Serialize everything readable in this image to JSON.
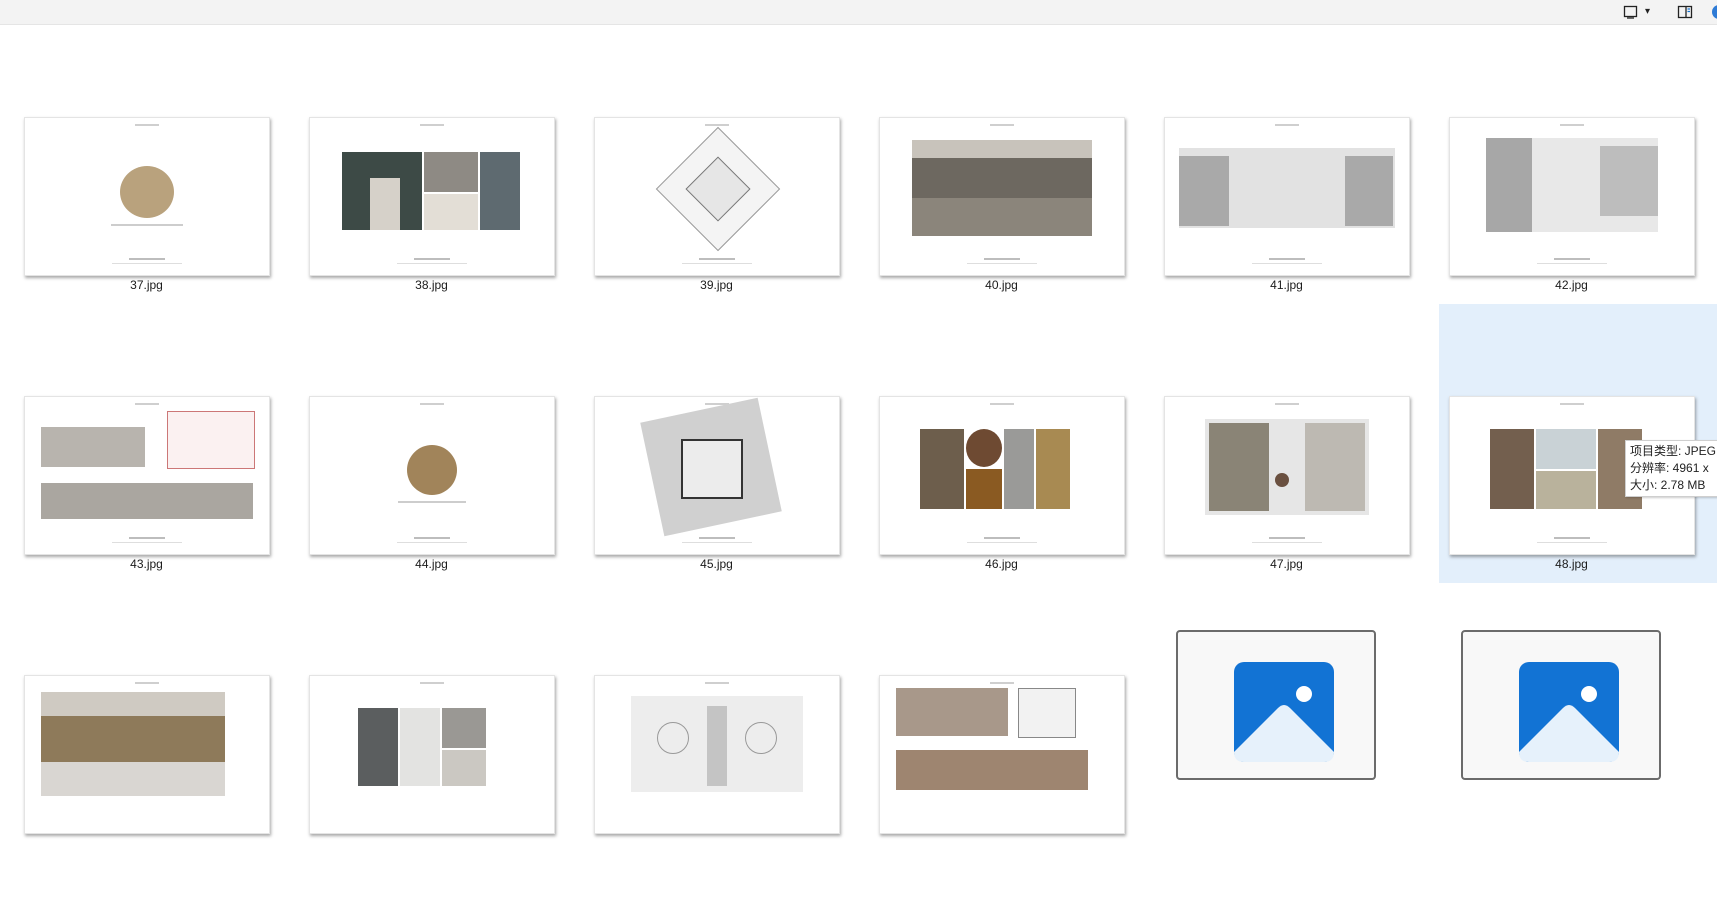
{
  "toolbar": {
    "view_icon": "monitor-icon",
    "view_caret": "▾",
    "details_pane_icon": "details-pane-icon"
  },
  "files": [
    {
      "name": "37.jpg"
    },
    {
      "name": "38.jpg"
    },
    {
      "name": "39.jpg"
    },
    {
      "name": "40.jpg"
    },
    {
      "name": "41.jpg"
    },
    {
      "name": "42.jpg"
    },
    {
      "name": "43.jpg"
    },
    {
      "name": "44.jpg"
    },
    {
      "name": "45.jpg"
    },
    {
      "name": "46.jpg"
    },
    {
      "name": "47.jpg"
    },
    {
      "name": "48.jpg"
    }
  ],
  "tooltip": {
    "type_line": "项目类型: JPEG",
    "resolution_line": "分辨率: 4961 x",
    "size_line": "大小: 2.78 MB"
  },
  "colors": {
    "selection": "#e3effb",
    "photo_icon_blue": "#1273d4",
    "accent": "#2e7bd6"
  }
}
